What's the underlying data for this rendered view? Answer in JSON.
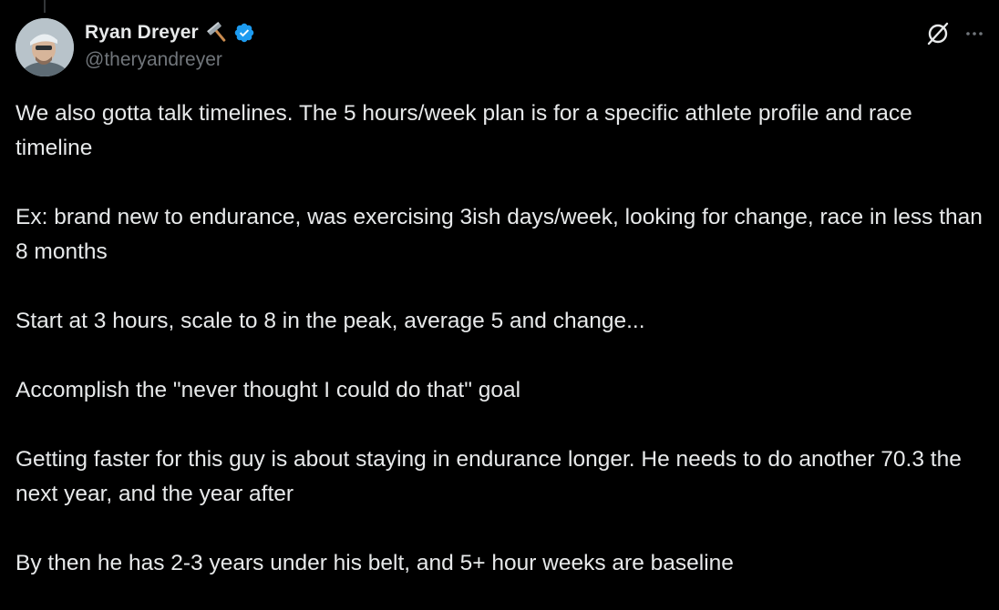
{
  "author": {
    "display_name": "Ryan Dreyer",
    "handle": "@theryandreyer",
    "name_emoji": "hammer-icon",
    "verified": true,
    "badge_color": "#1d9bf0"
  },
  "actions": {
    "grok_icon": "grok-icon",
    "more_icon": "more-icon"
  },
  "tweet": {
    "paragraphs": [
      "We also gotta talk timelines. The 5 hours/week plan is for a specific athlete profile and race timeline",
      "Ex: brand new to endurance, was exercising 3ish days/week, looking for change, race in less than 8 months",
      "Start at 3 hours, scale to 8 in the peak, average 5 and change...",
      "Accomplish the \"never thought I could do that\" goal",
      "Getting faster for this guy is about staying in endurance longer. He needs to do another 70.3 the next year, and the year after",
      "By then he has 2-3 years under his belt, and 5+ hour weeks are baseline"
    ]
  },
  "colors": {
    "background": "#000000",
    "text_primary": "#e7e9ea",
    "text_secondary": "#71767b",
    "accent": "#1d9bf0"
  }
}
